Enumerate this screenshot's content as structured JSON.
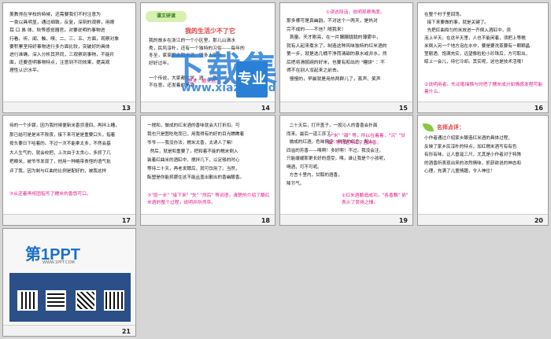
{
  "slides": [
    {
      "num": "13",
      "text": "美教师在学校的時候，还需要我们不时注意为\n一类以具明显，通过细致，反复，深刻的观察，用眼\n耳 口 鼻 体、秋等感觉器官，对要说明的事物进\n行看、听、闻、触、嗅、二、三、五、方面，观察对象\n要积累坚持好事物进行多方面比较，突破好的具体\n进行准确，深入分析其异同，三观察到事物，不能片\n面，还要查明事物特点，注意到不同效果，提高观\n理性认识水平。"
    },
    {
      "num": "14",
      "badge": "课文研读",
      "title": "我的生活少不了它",
      "text": "我的故乡在浙江的一个小区里，那儿山清水\n秀，民风淳朴，还有一个独特的习俗——每年的\n冬至，家家都会酿米酒，很多人家在\n好好过年。\n\n一个传说，大家都在学，酒……我\n不在意，还发着的米酒……",
      "note": "思考：酿米酒……年……传统……"
    },
    {
      "num": "15",
      "text": "那多哪可是真幽韵。不对这个一两天，是热对\n完不成的——不信？随我来！\n  首量。天才刚亮，在一片朦朦胧胧的薄雾中，\n就有人起来煮水了。制造这种风味独特的红米酒的\n第一步，就是选几桶干净而清甜的泉水或井水，然\n后把将滑腻碗的好米，也要有和出的 \"糟饼\" ：不\n得不在别人没起来之前去。\n  慢慢的，早晨就是用热两群儿了，蒸声、笑声",
      "top": "①读这段话，说明观察角度。"
    },
    {
      "num": "16",
      "text": "在整个村子里回荡。\n  接下来要做的事，就是关键了。\n  先把红曲和匀的米放进一齐倒入酒缸中，须\n泡上半天。在这半天里，人也不能闲着，须把上等糯\n米倒入另一个地方泡在水中，要是要洗蒸要有一颗颗晶\n莹剔透、饱满充实，远望像粒粒小珍珠后，方可取出，\n晾上一会儿，待它冷却。其实呢，这也是技术活哦！",
      "note": "②说明用者，先动笔描换与时把了糯米成分如情感发程可能着什么。"
    },
    {
      "num": "17",
      "text": "待的一个步骤，因为我时候便新米香弥漫四，再拌上糟，\n那已结可是是米不败夜，接下来可是是重要口头，指着\n按头要日下哈着的。不过一次不能拿太多，不然会基\n大人生气的，就会绞把，上次由于太贪心，多抓了几\n把粮米，被爷爷发现了，他用一种略带责怪的语气批\n评了我，因为制与红曲的比例是配好的，被我这样",
      "note": "③从还着再将固指写了糯米的香悠可口。"
    },
    {
      "num": "18",
      "text": "一搅和，做成的红米酒的香味就会大打折扣。可\n我也只是图吃吃而已，用我得有的好的目光瞧瞧着\n爷爷——我没办法，糯米太香，太诱人了嘛！\n  然后，就是和重要了，把和着不能的糯米倒入\n装着红曲米的酒缸中，搅拌几下，以足够的时心\n等待二十天，再老发酵后，就可饮用了。当然，\n酝塑是你能抓挪住这不能丛盖出散出的香幽酿香。",
      "note": "③\"层一步\" \"接下来\" \"失\" \"然后\" 等词语，清楚的介绍了酿红米酒的整个过程，说明并所然序。"
    },
    {
      "num": "19",
      "text": "  二十天后，打开盖子，一股沁人的香香会扑面\n而来。最后一道工序了：\n  做成的红酒，色味俱佳：鲜艳的红色，配上\n四溢的芳香——咦啊！多好啊！不过，我没会注，\n只能缓缓那更长好的感受，咦，谁让我是个小孩呢，\n喝酒，可不可呢。\n  方言十里内，甘醇的酒香，\n降节气。",
      "top": "③\"米\" \"甜\" 等，所以在着着，\"沉\" \"甘甜\" 等词语写出了酒的香。",
      "note": "①红米酒酿造成功，\"各香飘\" 依\" 表示了赞扬之情。"
    },
    {
      "num": "20",
      "badge": "名师点评：",
      "text": "小作者通过介绍家乡酿造红米酒的具体过程，\n反映了家乡民淳朴的特点，加红糯米酒写有有色\n有形有味，让人垂涎三尺，尤其是小作者对于特殊\n的酒香所表现出来的浓烈情味，抓获欲说的神态和\n心理，充满了儿童情趣，令人神往！"
    },
    {
      "num": "21",
      "logo": "第1PPT",
      "site": "WWW.1PPT.COM"
    }
  ],
  "watermark": {
    "text": "下载集",
    "badge": "专业",
    "url": "www.xiazai.red"
  },
  "colors": {
    "pink": "#e0198a",
    "blue": "#2a80d6",
    "red": "#e1281e"
  }
}
